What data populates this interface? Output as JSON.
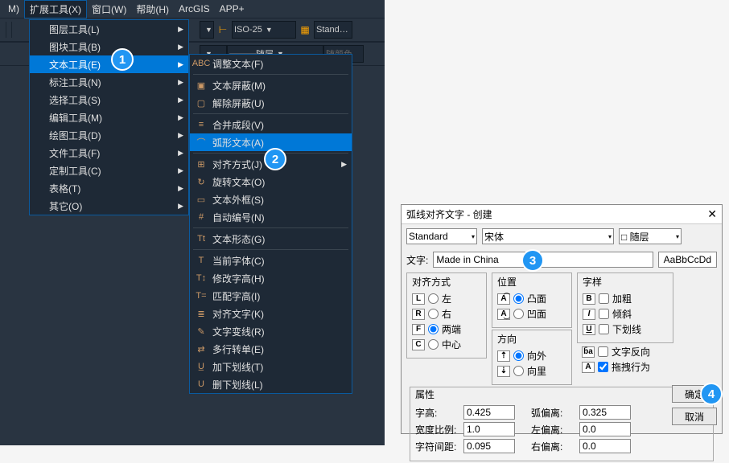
{
  "menubar": {
    "m": "M)",
    "ext": "扩展工具(X)",
    "win": "窗口(W)",
    "help": "帮助(H)",
    "arcgis": "ArcGIS",
    "app": "APP+"
  },
  "toolbar": {
    "combo1": "ISO-25",
    "combo2": "Stand…",
    "combo3": "随层",
    "combo4": "随颜色"
  },
  "menu1": [
    {
      "t": "图层工具(L)"
    },
    {
      "t": "图块工具(B)"
    },
    {
      "t": "文本工具(E)",
      "hl": true
    },
    {
      "t": "标注工具(N)"
    },
    {
      "t": "选择工具(S)"
    },
    {
      "t": "编辑工具(M)"
    },
    {
      "t": "绘图工具(D)"
    },
    {
      "t": "文件工具(F)"
    },
    {
      "t": "定制工具(C)"
    },
    {
      "t": "表格(T)"
    },
    {
      "t": "其它(O)"
    }
  ],
  "menu2": [
    {
      "t": "调整文本(F)"
    },
    {
      "sep": true
    },
    {
      "t": "文本屏蔽(M)"
    },
    {
      "t": "解除屏蔽(U)"
    },
    {
      "sep": true
    },
    {
      "t": "合并成段(V)"
    },
    {
      "t": "弧形文本(A)",
      "hl": true
    },
    {
      "sep": true
    },
    {
      "t": "对齐方式(J)",
      "arr": true
    },
    {
      "t": "旋转文本(O)"
    },
    {
      "t": "文本外框(S)"
    },
    {
      "t": "自动编号(N)"
    },
    {
      "sep": true
    },
    {
      "t": "文本形态(G)"
    },
    {
      "sep": true
    },
    {
      "t": "当前字体(C)"
    },
    {
      "t": "修改字高(H)"
    },
    {
      "t": "匹配字高(I)"
    },
    {
      "t": "对齐文字(K)"
    },
    {
      "t": "文字变线(R)"
    },
    {
      "t": "多行转单(E)"
    },
    {
      "t": "加下划线(T)"
    },
    {
      "t": "删下划线(L)"
    }
  ],
  "dialog": {
    "title": "弧线对齐文字 - 创建",
    "style": "Standard",
    "font": "宋体",
    "layer": "随层",
    "layer_sw": "□",
    "text_lbl": "文字:",
    "text_val": "Made in China",
    "sample": "AaBbCcDd",
    "align_t": "对齐方式",
    "align": [
      [
        "L",
        "左"
      ],
      [
        "R",
        "右"
      ],
      [
        "F",
        "两端",
        true
      ],
      [
        "C",
        "中心"
      ]
    ],
    "pos_t": "位置",
    "pos": [
      "凸面",
      "凹面"
    ],
    "pos_sel": 0,
    "dir_t": "方向",
    "dir": [
      "向外",
      "向里"
    ],
    "dir_sel": 0,
    "sty_t": "字样",
    "bold": "加粗",
    "italic": "倾斜",
    "under": "下划线",
    "rev": "文字反向",
    "drag": "拖拽行为",
    "props_t": "属性",
    "p1": "字高:",
    "v1": "0.425",
    "p2": "弧偏离:",
    "v2": "0.325",
    "p3": "宽度比例:",
    "v3": "1.0",
    "p4": "左偏离:",
    "v4": "0.0",
    "p5": "字符间距:",
    "v5": "0.095",
    "p6": "右偏离:",
    "v6": "0.0",
    "ok": "确定",
    "cancel": "取消"
  },
  "badges": {
    "b1": "1",
    "b2": "2",
    "b3": "3",
    "b4": "4"
  }
}
